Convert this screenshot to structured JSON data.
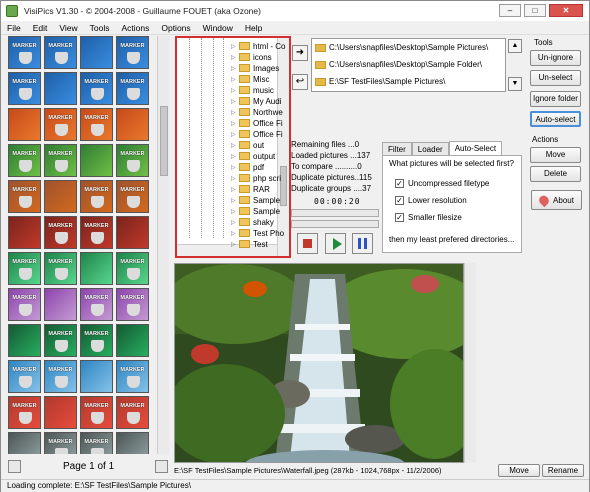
{
  "window": {
    "title": "VisiPics V1.30 - © 2004-2008 - Guillaume FOUET (aka Ozone)",
    "min": "–",
    "max": "□",
    "close": "✕"
  },
  "menu": [
    "File",
    "Edit",
    "View",
    "Tools",
    "Actions",
    "Options",
    "Window",
    "Help"
  ],
  "thumbnails": {
    "marker_label": "MARKER",
    "page_label": "Page 1 of 1"
  },
  "tree": {
    "items": [
      "html - Co",
      "icons",
      "Images",
      "Misc",
      "music",
      "My Audi",
      "Northwe",
      "Office Fi",
      "Office Fi",
      "out",
      "output",
      "pdf",
      "php scri",
      "RAR",
      "Sample",
      "Sample",
      "shaky",
      "Test Pho",
      "Test"
    ]
  },
  "dirs": [
    "C:\\Users\\snapfiles\\Desktop\\Sample Pictures\\",
    "C:\\Users\\snapfiles\\Desktop\\Sample Folder\\",
    "E:\\SF TestFiles\\Sample Pictures\\"
  ],
  "tools": {
    "header": "Tools",
    "unignore": "Un-ignore",
    "unselect": "Un-select",
    "ignore_folder": "Ignore folder",
    "auto_select": "Auto-select"
  },
  "actions": {
    "header": "Actions",
    "move": "Move",
    "delete": "Delete",
    "about": "About"
  },
  "stats": {
    "remaining": "Remaining files ...0",
    "loaded": "Loaded pictures ...137",
    "to_compare": "To compare ..........0",
    "duplicates": "Duplicate pictures..115",
    "groups": "Duplicate groups ....37",
    "timer": "00:00:20"
  },
  "tabs": {
    "filter": "Filter",
    "loader": "Loader",
    "autoselect": "Auto-Select"
  },
  "autoselect": {
    "question": "What pictures will be selected first?",
    "opt1": "Uncompressed filetype",
    "opt2": "Lower resolution",
    "opt3": "Smaller filesize",
    "then": "then my least prefered directories..."
  },
  "preview": {
    "path": "E:\\SF TestFiles\\Sample Pictures\\Waterfall.jpeg (287kb - 1024,768px - 11/2/2006)",
    "move": "Move",
    "rename": "Rename"
  },
  "status": "Loading complete: E:\\SF TestFiles\\Sample Pictures\\",
  "colors": {
    "accent": "#4a90d9",
    "tree_border": "#d32f2f"
  }
}
